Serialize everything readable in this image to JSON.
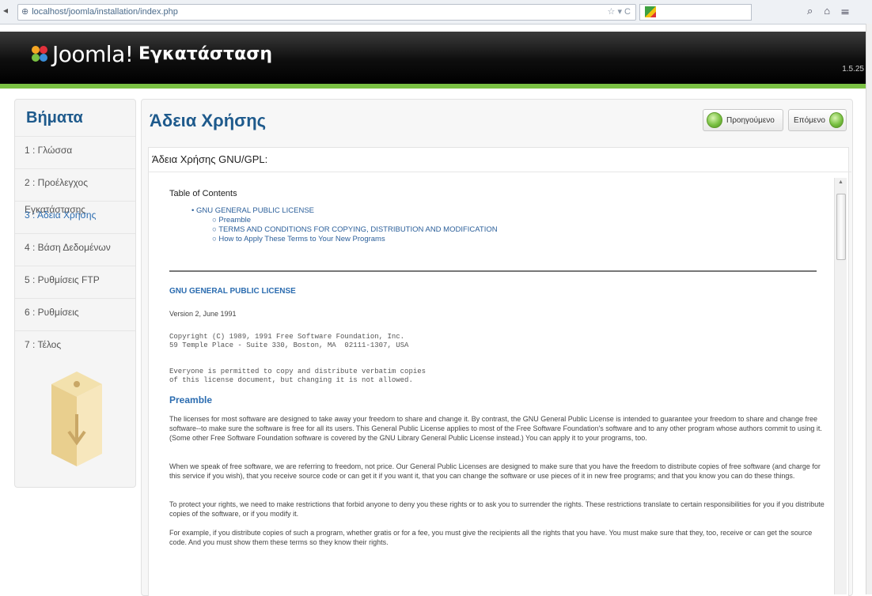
{
  "browser": {
    "url": "localhost/joomla/installation/index.php",
    "search_placeholder": ""
  },
  "header": {
    "brand": "Joomla!",
    "title": "Εγκατάσταση",
    "version": "1.5.25"
  },
  "sidebar": {
    "title": "Βήματα",
    "items": [
      {
        "label": "1 : Γλώσσα"
      },
      {
        "label": "2 : Προέλεγχος Εγκατάστασης"
      },
      {
        "label": "3 : Άδεια Χρήσης"
      },
      {
        "label": "4 : Βάση Δεδομένων"
      },
      {
        "label": "5 : Ρυθμίσεις FTP"
      },
      {
        "label": "6 : Ρυθμίσεις"
      },
      {
        "label": "7 : Τέλος"
      }
    ]
  },
  "main": {
    "title": "Άδεια Χρήσης",
    "prev_label": "Προηγούμενο",
    "next_label": "Επόμενο",
    "box_title": "Άδεια Χρήσης GNU/GPL:"
  },
  "doc": {
    "toc_title": "Table of Contents",
    "toc": [
      "GNU GENERAL PUBLIC LICENSE",
      "Preamble",
      "TERMS AND CONDITIONS FOR COPYING, DISTRIBUTION AND MODIFICATION",
      "How to Apply These Terms to Your New Programs"
    ],
    "gpl_title": "GNU GENERAL PUBLIC LICENSE",
    "version_line": "Version 2, June 1991",
    "copyright_1": "Copyright (C) 1989, 1991 Free Software Foundation, Inc.",
    "copyright_2": "59 Temple Place - Suite 330, Boston, MA  02111-1307, USA",
    "everyone_1": "Everyone is permitted to copy and distribute verbatim copies",
    "everyone_2": "of this license document, but changing it is not allowed.",
    "preamble_title": "Preamble",
    "p1": "The licenses for most software are designed to take away your freedom to share and change it. By contrast, the GNU General Public License is intended to guarantee your freedom to share and change free software--to make sure the software is free for all its users. This General Public License applies to most of the Free Software Foundation's software and to any other program whose authors commit to using it. (Some other Free Software Foundation software is covered by the GNU Library General Public License instead.) You can apply it to your programs, too.",
    "p2": "When we speak of free software, we are referring to freedom, not price. Our General Public Licenses are designed to make sure that you have the freedom to distribute copies of free software (and charge for this service if you wish), that you receive source code or can get it if you want it, that you can change the software or use pieces of it in new free programs; and that you know you can do these things.",
    "p3": "To protect your rights, we need to make restrictions that forbid anyone to deny you these rights or to ask you to surrender the rights. These restrictions translate to certain responsibilities for you if you distribute copies of the software, or if you modify it.",
    "p4": "For example, if you distribute copies of such a program, whether gratis or for a fee, you must give the recipients all the rights that you have. You must make sure that they, too, receive or can get the source code. And you must show them these terms so they know their rights."
  },
  "colors": {
    "accent_green": "#7ac143",
    "heading_blue": "#1e5a8c",
    "link_blue": "#2b5f9a"
  }
}
